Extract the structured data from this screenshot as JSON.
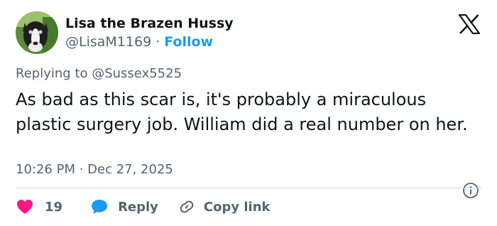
{
  "author": {
    "display_name": "Lisa the Brazen Hussy",
    "handle": "@LisaM1169",
    "separator": "·",
    "follow_label": "Follow"
  },
  "reply_context": {
    "prefix": "Replying to",
    "mention": "@Sussex5525"
  },
  "tweet": {
    "text": "As bad as this scar is, it's probably a miraculous plastic surgery job. William did a real number on her.",
    "timestamp": "10:26 PM · Dec 27, 2025"
  },
  "actions": {
    "like_count": "19",
    "reply_label": "Reply",
    "copy_link_label": "Copy link"
  },
  "colors": {
    "like": "#f91880",
    "reply": "#1d9bf0",
    "follow": "#1d9bf0",
    "secondary_text": "#536471",
    "primary_text": "#0f1419",
    "divider": "#cfd9de"
  },
  "icons": {
    "brand": "x-logo-icon",
    "info": "info-icon",
    "like": "heart-icon",
    "reply": "speech-bubble-icon",
    "copy_link": "link-icon",
    "avatar": "avatar-image"
  }
}
